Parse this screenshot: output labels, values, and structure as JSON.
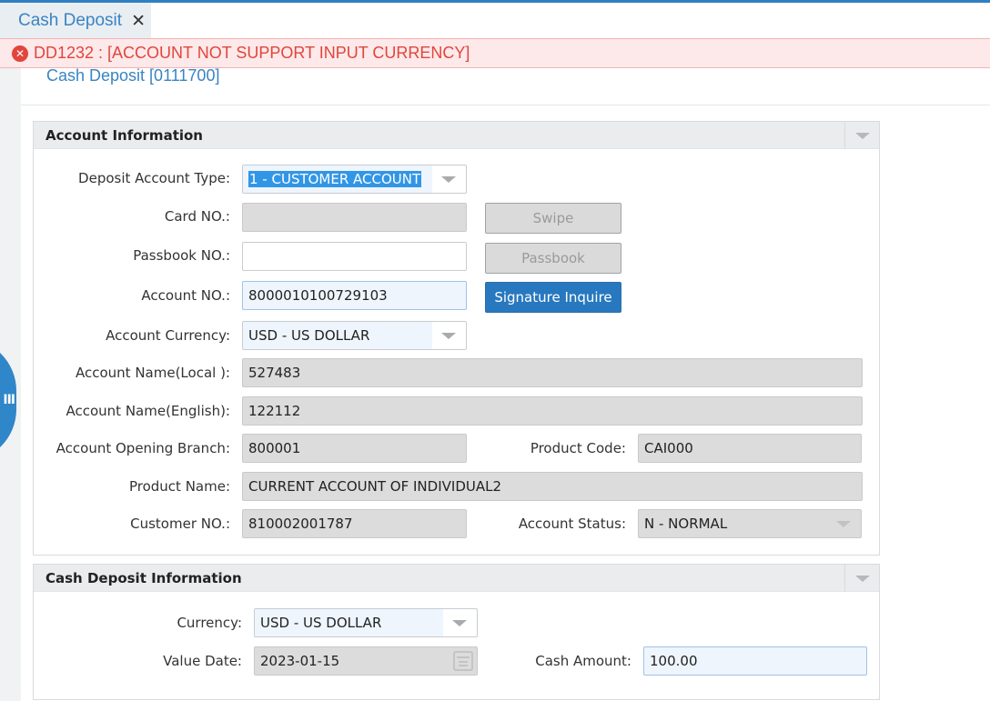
{
  "tab": {
    "label": "Cash Deposit",
    "close": "✕"
  },
  "error": {
    "icon": "✕",
    "message": "DD1232 : [ACCOUNT NOT SUPPORT INPUT CURRENCY]"
  },
  "page_title": "Cash Deposit [0111700]",
  "account_info": {
    "title": "Account Information",
    "deposit_account_type": {
      "label": "Deposit Account Type:",
      "value": "1 - CUSTOMER ACCOUNT"
    },
    "card_no": {
      "label": "Card NO.:",
      "value": ""
    },
    "swipe_button": "Swipe",
    "passbook_no": {
      "label": "Passbook NO.:",
      "value": ""
    },
    "passbook_button": "Passbook",
    "account_no": {
      "label": "Account NO.:",
      "value": "8000010100729103"
    },
    "signature_button": "Signature Inquire",
    "account_currency": {
      "label": "Account Currency:",
      "value": "USD - US DOLLAR"
    },
    "account_name_local": {
      "label": "Account Name(Local ):",
      "value": "527483"
    },
    "account_name_english": {
      "label": "Account Name(English):",
      "value": "122112"
    },
    "opening_branch": {
      "label": "Account Opening Branch:",
      "value": "800001"
    },
    "product_code": {
      "label": "Product Code:",
      "value": "CAI000"
    },
    "product_name": {
      "label": "Product Name:",
      "value": "CURRENT ACCOUNT OF INDIVIDUAL2"
    },
    "customer_no": {
      "label": "Customer NO.:",
      "value": "810002001787"
    },
    "account_status": {
      "label": "Account Status:",
      "value": "N - NORMAL"
    }
  },
  "cash_info": {
    "title": "Cash Deposit Information",
    "currency": {
      "label": "Currency:",
      "value": "USD - US DOLLAR"
    },
    "value_date": {
      "label": "Value Date:",
      "value": "2023-01-15"
    },
    "cash_amount": {
      "label": "Cash Amount:",
      "value": "100.00"
    }
  },
  "side_handle_icon": "III"
}
